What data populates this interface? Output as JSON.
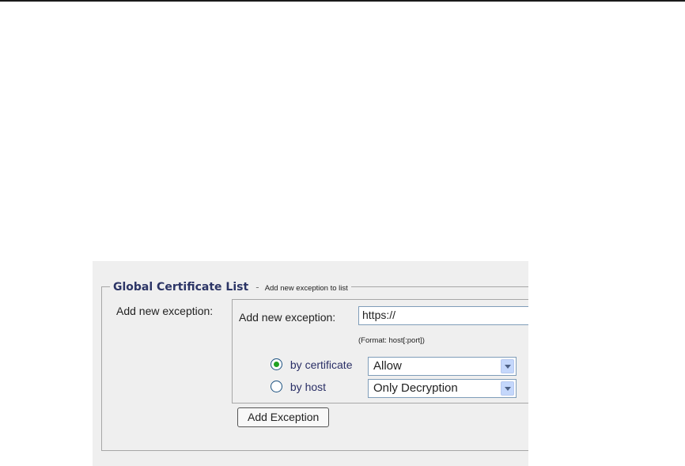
{
  "fieldset": {
    "title": "Global Certificate List",
    "separator": "-",
    "subtitle": "Add new exception to list"
  },
  "row_label": "Add new exception:",
  "form": {
    "url_label": "Add new exception:",
    "url_value": "https://",
    "format_hint": "(Format: host[:port])",
    "options": [
      {
        "label": "by certificate",
        "checked": true,
        "selected_value": "Allow"
      },
      {
        "label": "by host",
        "checked": false,
        "selected_value": "Only Decryption"
      }
    ],
    "add_button_label": "Add Exception"
  }
}
